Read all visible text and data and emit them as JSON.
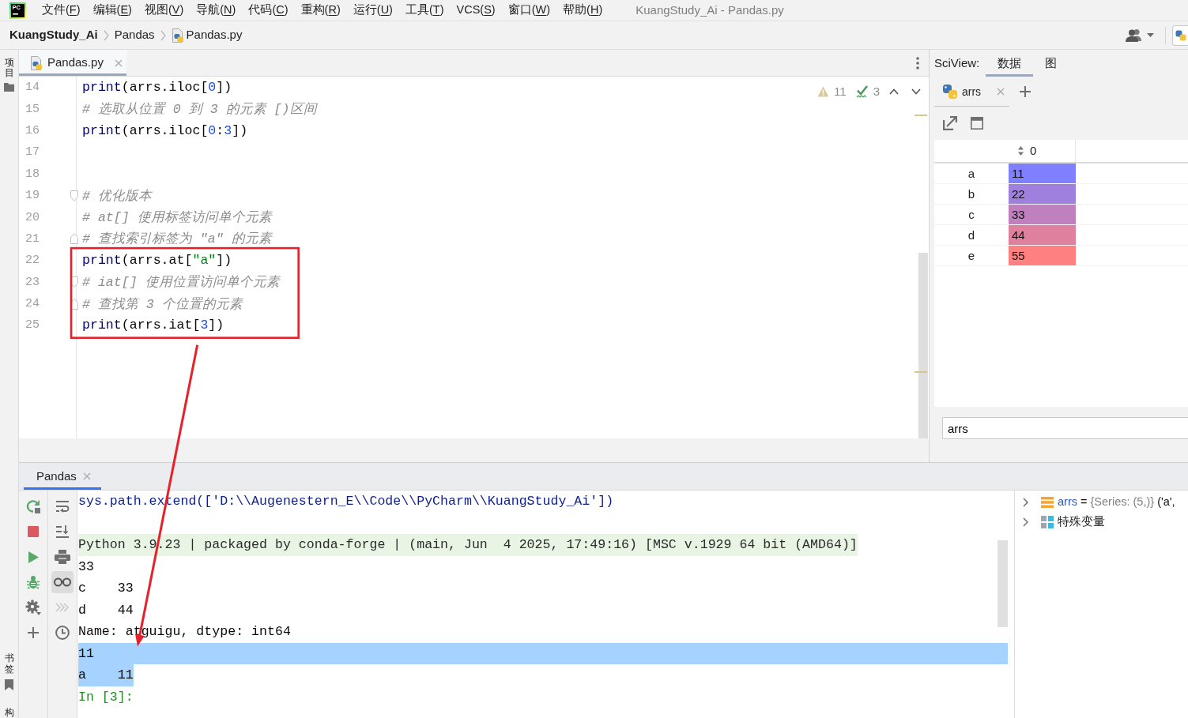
{
  "window": {
    "title": "KuangStudy_Ai - Pandas.py",
    "logo_text": "PC"
  },
  "menu": [
    {
      "text": "文件(",
      "key": "F",
      "tail": ")"
    },
    {
      "text": "编辑(",
      "key": "E",
      "tail": ")"
    },
    {
      "text": "视图(",
      "key": "V",
      "tail": ")"
    },
    {
      "text": "导航(",
      "key": "N",
      "tail": ")"
    },
    {
      "text": "代码(",
      "key": "C",
      "tail": ")"
    },
    {
      "text": "重构(",
      "key": "R",
      "tail": ")"
    },
    {
      "text": "运行(",
      "key": "U",
      "tail": ")"
    },
    {
      "text": "工具(",
      "key": "T",
      "tail": ")"
    },
    {
      "text": "VCS(",
      "key": "S",
      "tail": ")"
    },
    {
      "text": "窗口(",
      "key": "W",
      "tail": ")"
    },
    {
      "text": "帮助(",
      "key": "H",
      "tail": ")"
    }
  ],
  "breadcrumbs": [
    {
      "label": "KuangStudy_Ai",
      "kind": "project"
    },
    {
      "label": "Pandas",
      "kind": "folder"
    },
    {
      "label": "Pandas.py",
      "kind": "file"
    }
  ],
  "left_strip": {
    "top": [
      {
        "label": "项目",
        "kind": "project"
      }
    ],
    "bottom": [
      {
        "label": "书签",
        "kind": "bookmarks"
      },
      {
        "label": "构",
        "kind": "structure"
      }
    ]
  },
  "editor": {
    "tabs": [
      {
        "label": "Pandas.py",
        "selected": true
      }
    ],
    "inspections": [
      {
        "kind": "warning",
        "count": "11"
      },
      {
        "kind": "typo",
        "count": "3"
      }
    ],
    "lines": [
      {
        "number": "14",
        "framed": false,
        "fold_start": false,
        "fold_end": false,
        "segments": [
          {
            "text": "print",
            "kind": "builtin"
          },
          {
            "text": "(arrs.iloc[",
            "kind": "plain"
          },
          {
            "text": "0",
            "kind": "number"
          },
          {
            "text": "])",
            "kind": "plain"
          }
        ]
      },
      {
        "number": "15",
        "framed": false,
        "fold_start": false,
        "fold_end": false,
        "segments": [
          {
            "text": "# 选取从位置 0 到 3 的元素 [)区间",
            "kind": "comment"
          }
        ]
      },
      {
        "number": "16",
        "framed": false,
        "fold_start": false,
        "fold_end": false,
        "segments": [
          {
            "text": "print",
            "kind": "builtin"
          },
          {
            "text": "(arrs.iloc[",
            "kind": "plain"
          },
          {
            "text": "0",
            "kind": "number"
          },
          {
            "text": ":",
            "kind": "plain"
          },
          {
            "text": "3",
            "kind": "number"
          },
          {
            "text": "])",
            "kind": "plain"
          }
        ]
      },
      {
        "number": "17",
        "framed": false,
        "fold_start": false,
        "fold_end": false
      },
      {
        "number": "18",
        "framed": false,
        "fold_start": false,
        "fold_end": false
      },
      {
        "number": "19",
        "framed": false,
        "fold_start": true,
        "fold_end": false,
        "segments": [
          {
            "text": "# 优化版本",
            "kind": "comment"
          }
        ]
      },
      {
        "number": "20",
        "framed": false,
        "fold_start": false,
        "fold_end": false,
        "segments": [
          {
            "text": "# at[] 使用标签访问单个元素",
            "kind": "comment"
          }
        ]
      },
      {
        "number": "21",
        "framed": false,
        "fold_start": false,
        "fold_end": true,
        "segments": [
          {
            "text": "# 查找索引标签为 \"a\" 的元素",
            "kind": "comment"
          }
        ]
      },
      {
        "number": "22",
        "framed": true,
        "fold_start": false,
        "fold_end": false,
        "segments": [
          {
            "text": "print",
            "kind": "builtin"
          },
          {
            "text": "(arrs.at[",
            "kind": "plain"
          },
          {
            "text": "\"a\"",
            "kind": "string"
          },
          {
            "text": "])",
            "kind": "plain"
          }
        ]
      },
      {
        "number": "23",
        "framed": true,
        "fold_start": true,
        "fold_end": false,
        "segments": [
          {
            "text": "# iat[] 使用位置访问单个元素",
            "kind": "comment"
          }
        ]
      },
      {
        "number": "24",
        "framed": true,
        "fold_start": false,
        "fold_end": true,
        "segments": [
          {
            "text": "# 查找第 3 个位置的元素",
            "kind": "comment"
          }
        ]
      },
      {
        "number": "25",
        "framed": true,
        "fold_start": false,
        "fold_end": false,
        "segments": [
          {
            "text": "print",
            "kind": "builtin"
          },
          {
            "text": "(arrs.iat[",
            "kind": "plain"
          },
          {
            "text": "3",
            "kind": "number"
          },
          {
            "text": "])",
            "kind": "plain"
          }
        ]
      }
    ]
  },
  "sciview": {
    "label": "SciView:",
    "tabs": [
      {
        "label": "数据",
        "selected": true
      },
      {
        "label": "图",
        "selected": false
      }
    ],
    "data_tabs": [
      {
        "label": "arrs",
        "selected": true
      }
    ],
    "table": {
      "columns": [
        "0"
      ],
      "rows": [
        {
          "index": "a",
          "value": "11",
          "color": "#8080ff"
        },
        {
          "index": "b",
          "value": "22",
          "color": "#a080df"
        },
        {
          "index": "c",
          "value": "33",
          "color": "#c080bf"
        },
        {
          "index": "d",
          "value": "44",
          "color": "#e0809f"
        },
        {
          "index": "e",
          "value": "55",
          "color": "#ff8080"
        }
      ]
    },
    "filter": {
      "value": "arrs"
    }
  },
  "console": {
    "tabs": [
      {
        "label": "Pandas",
        "selected": true
      }
    ],
    "tools": [
      {
        "kind": "wrap",
        "on": false,
        "disabled": false
      },
      {
        "kind": "scroll_end",
        "on": false,
        "disabled": false
      },
      {
        "kind": "print",
        "on": false,
        "disabled": false
      },
      {
        "kind": "glasses",
        "on": true,
        "disabled": false
      },
      {
        "kind": "forward",
        "on": false,
        "disabled": true
      },
      {
        "kind": "history",
        "on": false,
        "disabled": false
      }
    ],
    "lines": [
      {
        "kind": "input",
        "text": "sys.path.extend(['D:\\\\Augenestern_E\\\\Code\\\\PyCharm\\\\KuangStudy_Ai'])",
        "selected": false
      },
      {
        "kind": "blank",
        "selected": false
      },
      {
        "kind": "banner",
        "text": "Python 3.9.23 | packaged by conda-forge | (main, Jun  4 2025, 17:49:16) [MSC v.1929 64 bit (AMD64)]",
        "selected": false
      },
      {
        "kind": "output",
        "text": "33",
        "selected": false
      },
      {
        "kind": "output",
        "text": "c    33",
        "selected": false
      },
      {
        "kind": "output",
        "text": "d    44",
        "selected": false
      },
      {
        "kind": "output",
        "text": "Name: atguigu, dtype: int64",
        "selected": false
      },
      {
        "kind": "output",
        "text": "11",
        "selected": true
      },
      {
        "kind": "output",
        "text": "a    11",
        "selected": true
      },
      {
        "kind": "prompt",
        "text": "In [3]:",
        "selected": false
      }
    ]
  },
  "variables": [
    {
      "kind": "series",
      "expanded": false,
      "segments": [
        {
          "text": "arrs",
          "kind": "name"
        },
        {
          "text": " = ",
          "kind": "plain"
        },
        {
          "text": "{Series: (5,)}",
          "kind": "type"
        },
        {
          "text": " ('a',",
          "kind": "plain"
        }
      ]
    },
    {
      "kind": "special",
      "expanded": false,
      "segments": [
        {
          "text": "特殊变量",
          "kind": "plain"
        }
      ]
    }
  ],
  "annotation_arrow": true
}
